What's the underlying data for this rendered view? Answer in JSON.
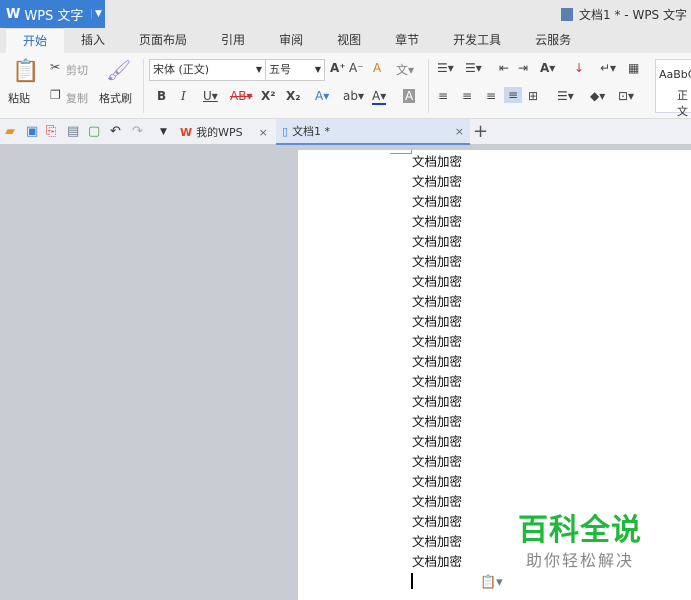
{
  "app": {
    "name": "WPS 文字",
    "window_title": "文档1 * - WPS 文字"
  },
  "menu_tabs": [
    "开始",
    "插入",
    "页面布局",
    "引用",
    "审阅",
    "视图",
    "章节",
    "开发工具",
    "云服务"
  ],
  "ribbon": {
    "paste": "粘贴",
    "cut": "剪切",
    "copy": "复制",
    "format_painter": "格式刷",
    "font": "宋体 (正文)",
    "size": "五号",
    "style_preview": "AaBbC",
    "style_name": "正文"
  },
  "doc_tabs": [
    {
      "label": "我的WPS"
    },
    {
      "label": "文档1 *"
    }
  ],
  "document": {
    "lines": [
      "文档加密",
      "文档加密",
      "文档加密",
      "文档加密",
      "文档加密",
      "文档加密",
      "文档加密",
      "文档加密",
      "文档加密",
      "文档加密",
      "文档加密",
      "文档加密",
      "文档加密",
      "文档加密",
      "文档加密",
      "文档加密",
      "文档加密",
      "文档加密",
      "文档加密",
      "文档加密",
      "文档加密"
    ]
  },
  "watermark": {
    "title": "百科全说",
    "subtitle": "助你轻松解决"
  },
  "colors": {
    "accent": "#3b7fd4",
    "watermark_green": "#1fb83a"
  }
}
